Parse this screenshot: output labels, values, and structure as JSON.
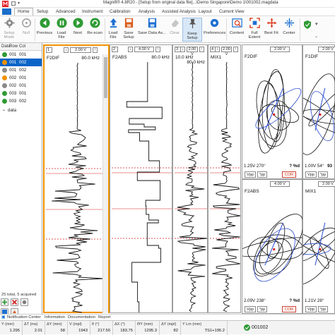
{
  "window": {
    "title": "Magnifi® 4.8R20 - [Setup from original data file]...\\Demo Singapore\\Demo 1\\001002.magdata"
  },
  "menu": {
    "tabs": [
      "Home",
      "Setup",
      "Advanced",
      "Instrument",
      "Calibration",
      "Analysis",
      "Assisted Analysis",
      "Layout",
      "Current View"
    ]
  },
  "ribbon": {
    "setup_mode": "Setup Mode",
    "null": "Null",
    "previous": "Previous",
    "load_file": "Load File",
    "next": "Next",
    "rescan": "Re-scan",
    "load_file2": "Load File",
    "save_setup": "Save Setup",
    "save_data_as": "Save Data As...",
    "clear": "Clear",
    "keep_setup": "Keep Setup",
    "preferences": "Preferences",
    "content": "Content",
    "full_extent": "Full Extent",
    "best_fit": "Best Fit",
    "center": "Center"
  },
  "left_panel": {
    "header_data": "Data",
    "header_row": "Row",
    "header_col": "Col",
    "rows": [
      {
        "row": "001",
        "col": "001",
        "status": "green",
        "selected": false
      },
      {
        "row": "001",
        "col": "002",
        "status": "orange",
        "selected": true
      },
      {
        "row": "001",
        "col": "002",
        "status": "gray",
        "selected": false
      },
      {
        "row": "002",
        "col": "001",
        "status": "orange",
        "selected": false
      },
      {
        "row": "002",
        "col": "001",
        "status": "gray",
        "selected": false
      },
      {
        "row": "003",
        "col": "001",
        "status": "green",
        "selected": false
      },
      {
        "row": "003",
        "col": "002",
        "status": "green",
        "selected": false
      }
    ],
    "footer_item": "data",
    "count_text": "25 total, 5 acquired"
  },
  "strip_charts": [
    {
      "num": "1",
      "volts": "2.00 V",
      "name": "F2DIF",
      "freq": "80.0 kHz"
    },
    {
      "num": "2",
      "volts": "4.00 V",
      "name": "F2ABS",
      "freq": "80.0 kHz"
    },
    {
      "num": "3",
      "volts": "2.00 V",
      "name": "10.0 kHz",
      "freq": "80.0 kHz"
    },
    {
      "num": "4",
      "volts": "2.00 V",
      "name": "MIX1",
      "freq": ""
    }
  ],
  "lissajous": [
    {
      "volts": "2.00 V",
      "name": "F2DIF",
      "reading": "1.25V 270°",
      "pct": "? %d",
      "vpp": "Vpp",
      "tp": "°pp",
      "cor": "COR"
    },
    {
      "volts": "2.00 V",
      "name": "F1DIF",
      "reading": "1.00V 54°",
      "pct": "93",
      "vpp": "Vpp",
      "tp": "°pp",
      "cor": ""
    },
    {
      "volts": "4.00 V",
      "name": "F2ABS",
      "reading": "2.09V 238°",
      "pct": "? %d",
      "vpp": "Vpp",
      "tp": "°pp",
      "cor": "COR"
    },
    {
      "volts": "2.00 V",
      "name": "MIX1",
      "reading": "1.21V 28°",
      "pct": "",
      "vpp": "Vpp",
      "tp": "°pp",
      "cor": ""
    }
  ],
  "bottom_tabs": [
    "Notification Center",
    "Information",
    "Documentation",
    "Report"
  ],
  "status": {
    "cells": [
      {
        "h": "Y (mm)",
        "v": "1.295"
      },
      {
        "h": "ΔT (ms)",
        "v": "2.01"
      },
      {
        "h": "ΔY (mm)",
        "v": "58"
      },
      {
        "h": "V (mpl)",
        "v": "1943"
      },
      {
        "h": "θ (°)",
        "v": "217.50"
      },
      {
        "h": "ΔX (°)",
        "v": "183.75"
      },
      {
        "h": "ΘY (mm)",
        "v": "1295.3"
      },
      {
        "h": "ΔY (mpl)",
        "v": "82"
      },
      {
        "h": "Y Lm (mm)",
        "v": "TS1+195.2"
      }
    ],
    "file": "001002"
  },
  "colors": {
    "accent": "#0a64c8",
    "selection_orange": "#f09200",
    "marker_red": "#d22020",
    "trace": "#111111",
    "trace_blue": "#2a4bd4"
  }
}
